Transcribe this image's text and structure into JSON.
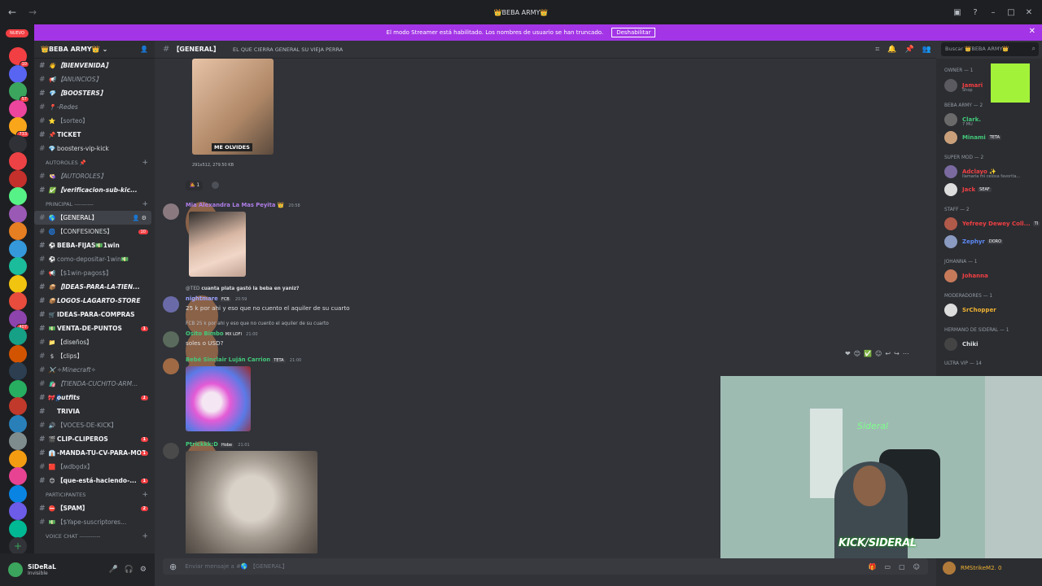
{
  "titlebar": {
    "title": "👑BEBA ARMY👑"
  },
  "banner": {
    "text": "El modo Streamer está habilitado. Los nombres de usuario se han truncado.",
    "button": "Deshabilitar"
  },
  "servers": {
    "nuevo": "NUEVO",
    "badges": [
      "10",
      "",
      "57",
      "",
      "733",
      "",
      "",
      "",
      "",
      "",
      "",
      "",
      "",
      "",
      "",
      "407",
      "",
      "",
      "",
      "",
      "",
      "",
      "",
      "",
      "",
      "",
      "",
      "",
      "",
      ""
    ]
  },
  "server_header": {
    "name": "👑BEBA ARMY👑"
  },
  "channels": [
    {
      "type": "text",
      "emoji": "👋",
      "label": "【BIENVENIDA】",
      "style": "bold ital"
    },
    {
      "type": "text",
      "emoji": "📢",
      "label": "【ANUNCIOS】",
      "style": "ital"
    },
    {
      "type": "text",
      "emoji": "💎",
      "label": "【BOOSTERS】",
      "style": "bold ital"
    },
    {
      "type": "text",
      "emoji": "📍",
      "label": "-Redes",
      "style": "ital"
    },
    {
      "type": "text",
      "emoji": "⭐",
      "label": "【sorteo】",
      "style": ""
    },
    {
      "type": "text",
      "emoji": "📌",
      "label": "TICKET",
      "style": "bold"
    },
    {
      "type": "text",
      "emoji": "💎",
      "label": "boosters-vip-kick",
      "style": "white"
    },
    {
      "type": "cat",
      "label": "AUTOROLES 📌"
    },
    {
      "type": "text",
      "emoji": "👒",
      "label": "【AUTOROLES】",
      "style": "ital"
    },
    {
      "type": "text",
      "emoji": "✅",
      "label": "【verificacion-sub-kic...",
      "style": "bold ital"
    },
    {
      "type": "cat",
      "label": "PRINCIPAL ----------"
    },
    {
      "type": "text",
      "emoji": "🌎",
      "label": "【GENERAL】",
      "style": "active"
    },
    {
      "type": "text",
      "emoji": "🌀",
      "label": "【CONFESIONES】",
      "style": "white",
      "badge": "10"
    },
    {
      "type": "text",
      "emoji": "⚽",
      "label": "BEBA-FIJAS💵1win",
      "style": "bold"
    },
    {
      "type": "text",
      "emoji": "⚽",
      "label": "como-depositar-1win💵",
      "style": ""
    },
    {
      "type": "text",
      "emoji": "📢",
      "label": "【$1win-pagos$】",
      "style": ""
    },
    {
      "type": "text",
      "emoji": "📦",
      "label": "【IDEAS-PARA-LA-TIEN...",
      "style": "bold ital"
    },
    {
      "type": "text",
      "emoji": "📦",
      "label": "LOGOS-LAGARTO-STORE",
      "style": "bold ital"
    },
    {
      "type": "text",
      "emoji": "🛒",
      "label": "IDEAS-PARA-COMPRAS",
      "style": "bold"
    },
    {
      "type": "text",
      "emoji": "💵",
      "label": "VENTA-DE-PUNTOS",
      "style": "bold",
      "badge": "1"
    },
    {
      "type": "text",
      "emoji": "📁",
      "label": "【diseños】",
      "style": "white"
    },
    {
      "type": "text",
      "emoji": "$",
      "label": "【clips】",
      "style": "white"
    },
    {
      "type": "text",
      "emoji": "⚔️",
      "label": "✧Minecraft✧",
      "style": "ital"
    },
    {
      "type": "text",
      "emoji": "🛍️",
      "label": "【TIENDA-CUCHITO-ARM...",
      "style": "ital"
    },
    {
      "type": "text",
      "emoji": "🎀👖",
      "label": "outfits",
      "style": "bold ital",
      "badge": "1"
    },
    {
      "type": "text",
      "emoji": "",
      "label": "TRIVIA",
      "style": "bold"
    },
    {
      "type": "text",
      "emoji": "🔊",
      "label": "【VOCES-DE-KICK】",
      "style": ""
    },
    {
      "type": "text",
      "emoji": "🎬",
      "label": "CLIP-CLIPEROS",
      "style": "bold",
      "badge": "1"
    },
    {
      "type": "text",
      "emoji": "👔",
      "label": "-MANDA-TU-CV-PARA-MOD",
      "style": "bold",
      "badge": "1"
    },
    {
      "type": "text",
      "emoji": "🟥",
      "label": "【ʍdbǫdx】",
      "style": ""
    },
    {
      "type": "text",
      "emoji": "😊",
      "label": "【que-está-haciendo-...",
      "style": "bold",
      "badge": "1"
    },
    {
      "type": "cat",
      "label": "PARTICIPANTES"
    },
    {
      "type": "text",
      "emoji": "⛔",
      "label": "【SPAM】",
      "style": "bold",
      "badge": "2"
    },
    {
      "type": "text",
      "emoji": "💵",
      "label": "【$Yape-suscriptores...",
      "style": ""
    },
    {
      "type": "cat",
      "label": "VOICE CHAT -----------"
    }
  ],
  "user_panel": {
    "name": "SiDeRaL",
    "status": "Invisible"
  },
  "chanbar": {
    "name": "【GENERAL】",
    "topic": "EL QUE CIERRA GENERAL SU VIEJA PERRA"
  },
  "search": {
    "placeholder": "Buscar 👑BEBA ARMY👑"
  },
  "messages": {
    "m0": {
      "caption": "ME OLVIDES",
      "fileinfo": "291x512, 279.50 KB",
      "reaction_count": "1"
    },
    "m1": {
      "author": "Mia Alexandra La Mas Peyita",
      "time": "20:58"
    },
    "m2": {
      "reply_author": "@TED",
      "reply_text": "cuanta plata gastó la beba en yaniz?",
      "author": "nightmare",
      "tag": "FCB",
      "time": "20:59",
      "text": "25 k por ahi y eso que no cuento el aquiler de su cuarto"
    },
    "m3": {
      "reply_author": "FCB",
      "reply_text": "25 k por ahi y eso que no cuento el aquiler de su cuarto",
      "author": "Osito Bimbo",
      "tags": "MX LOFI",
      "time": "21:00",
      "text": "soles o USD?"
    },
    "m4": {
      "author": "Bebé Sinclair Luján Carrion",
      "tag": "TETA",
      "time": "21:00"
    },
    "m5": {
      "author": "Ptrickkk:D",
      "tag": "Hobe",
      "time": "21:01"
    }
  },
  "composer": {
    "placeholder": "Enviar mensaje a #🌎 【GENERAL】"
  },
  "members": {
    "groups": [
      {
        "label": "OWNER — 1"
      },
      {
        "label": "BEBA ARMY — 2"
      },
      {
        "label": "SUPER MOD — 2"
      },
      {
        "label": "STAFF — 2"
      },
      {
        "label": "Johanna — 1"
      },
      {
        "label": "MODERADORES — 1"
      },
      {
        "label": "hermano de sideral — 1"
      },
      {
        "label": "ULTRA VIP — 14"
      }
    ],
    "list": [
      {
        "name": "Jamari",
        "color": "#f23f43",
        "status": "Shop"
      },
      {
        "name": "Clark.",
        "color": "#43c97a",
        "status": "7 MU"
      },
      {
        "name": "Minami",
        "color": "#43c97a",
        "tag": "TETA"
      },
      {
        "name": "Adclayo ✨",
        "color": "#f23f43",
        "status": "llamaría mi celosa favorita..."
      },
      {
        "name": "Jack",
        "color": "#f23f43",
        "tag": "SEAF"
      },
      {
        "name": "Yefreey Dewey Coll...",
        "color": "#f23f43",
        "tag": "TI"
      },
      {
        "name": "Zephyr",
        "color": "#5e8af7",
        "tag": "DORO"
      },
      {
        "name": "Johanna",
        "color": "#f23f43"
      },
      {
        "name": "SrChopper",
        "color": "#f0b232"
      },
      {
        "name": "Chiki",
        "color": "#dbdee1"
      }
    ],
    "bottom": {
      "name": "RMStrikeM2. 0"
    }
  },
  "webcam": {
    "overlay": "KICK/SIDERAL",
    "logo": "Sideral"
  }
}
